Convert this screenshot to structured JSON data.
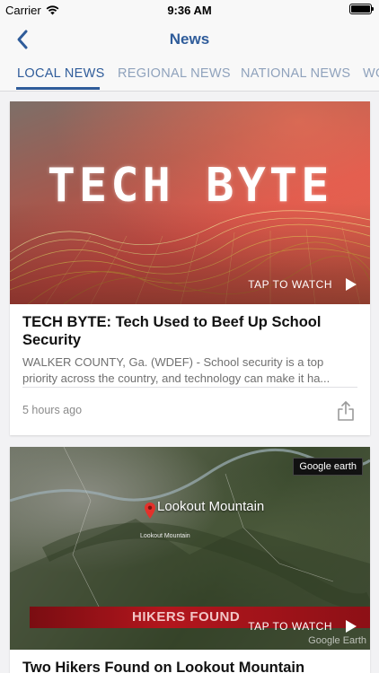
{
  "status_bar": {
    "carrier": "Carrier",
    "time": "9:36 AM"
  },
  "nav": {
    "title": "News"
  },
  "tabs": [
    {
      "label": "LOCAL NEWS",
      "active": true
    },
    {
      "label": "REGIONAL NEWS",
      "active": false
    },
    {
      "label": "NATIONAL NEWS",
      "active": false
    },
    {
      "label": "WO",
      "active": false
    }
  ],
  "articles": [
    {
      "image_text": "TECH BYTE",
      "watch_label": "TAP TO WATCH",
      "headline": "TECH BYTE: Tech Used to Beef Up School Security",
      "summary": "WALKER COUNTY, Ga. (WDEF) - School security is a top priority across the country, and technology can make it ha...",
      "timestamp": "5 hours ago"
    },
    {
      "map_label": "Lookout Mountain",
      "map_small_label": "Lookout Mountain",
      "badge": "Google earth",
      "banner_text": "HIKERS FOUND",
      "watermark": "Google Earth",
      "watch_label": "TAP TO WATCH",
      "headline": "Two Hikers Found on Lookout Mountain"
    }
  ],
  "colors": {
    "accent": "#2f5c9a",
    "inactive_tab": "#8fa2bc"
  }
}
